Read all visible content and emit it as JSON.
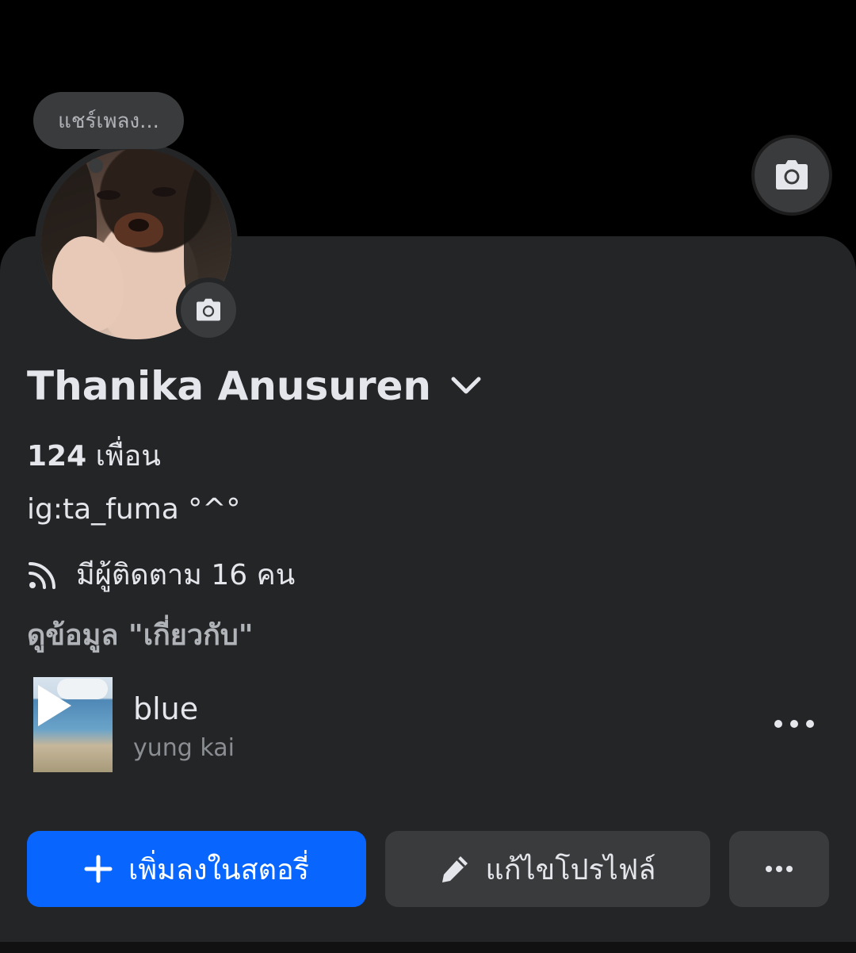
{
  "note": {
    "text": "แชร์เพลง..."
  },
  "profile": {
    "name": "Thanika Anusuren",
    "friends_count": "124",
    "friends_label": "เพื่อน",
    "bio": "ig:ta_fuma °^°",
    "followers_text": "มีผู้ติดตาม 16 คน",
    "about_link": "ดูข้อมูล \"เกี่ยวกับ\""
  },
  "music": {
    "title": "blue",
    "artist": "yung kai"
  },
  "actions": {
    "add_story": "เพิ่มลงในสตอรี่",
    "edit_profile": "แก้ไขโปรไฟล์"
  },
  "icons": {
    "cover_camera": "camera-icon",
    "avatar_camera": "camera-icon",
    "name_menu": "chevron-down-icon",
    "followers": "rss-icon",
    "play": "play-icon",
    "music_more": "more-horizontal-icon",
    "add": "plus-icon",
    "edit": "pencil-icon",
    "more": "more-horizontal-icon"
  },
  "colors": {
    "background": "#000000",
    "card": "#242526",
    "primary_button": "#0866ff",
    "secondary_button": "#3a3b3c",
    "text_primary": "#e4e6eb",
    "text_secondary": "#b0b3b8"
  }
}
